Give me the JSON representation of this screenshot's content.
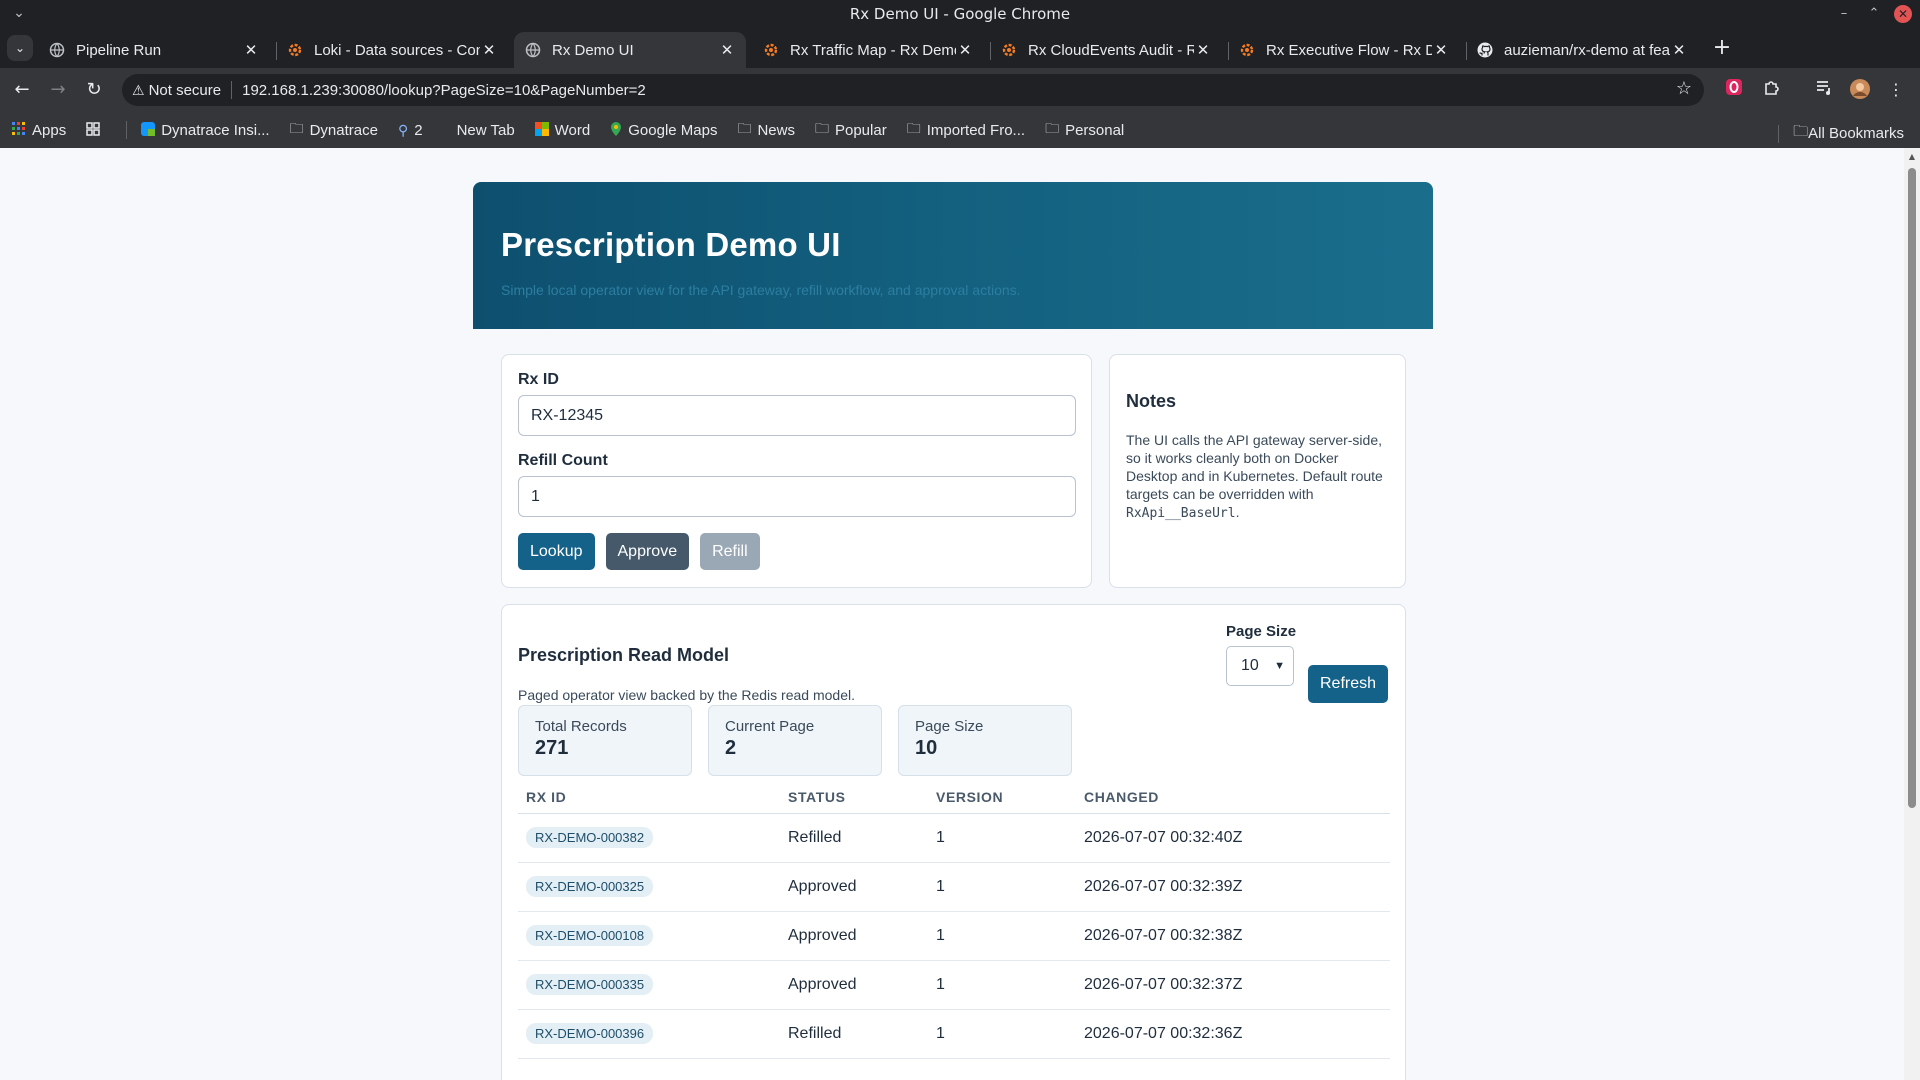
{
  "window": {
    "title": "Rx Demo UI - Google Chrome"
  },
  "tabs": [
    {
      "label": "Pipeline Run",
      "icon": "globe-icon"
    },
    {
      "label": "Loki - Data sources - Con",
      "icon": "grafana-icon"
    },
    {
      "label": "Rx Demo UI",
      "icon": "globe-icon"
    },
    {
      "label": "Rx Traffic Map - Rx Demo",
      "icon": "grafana-icon"
    },
    {
      "label": "Rx CloudEvents Audit - R",
      "icon": "grafana-icon"
    },
    {
      "label": "Rx Executive Flow - Rx De",
      "icon": "grafana-icon"
    },
    {
      "label": "auzieman/rx-demo at fea",
      "icon": "github-icon"
    }
  ],
  "omnibox": {
    "security": "Not secure",
    "url": "192.168.1.239:30080/lookup?PageSize=10&PageNumber=2"
  },
  "bookmarks": {
    "items": [
      {
        "label": "Apps",
        "icon": "apps-grid-icon"
      },
      {
        "label": "Dynatrace Insi...",
        "icon": "dynatrace-icon"
      },
      {
        "label": "Dynatrace",
        "icon": "folder-icon"
      },
      {
        "label": "2",
        "icon": "search-icon"
      },
      {
        "label": "New Tab",
        "icon": "blank-icon"
      },
      {
        "label": "Word",
        "icon": "word-icon"
      },
      {
        "label": "Google Maps",
        "icon": "maps-icon"
      },
      {
        "label": "News",
        "icon": "folder-icon"
      },
      {
        "label": "Popular",
        "icon": "folder-icon"
      },
      {
        "label": "Imported Fro...",
        "icon": "folder-icon"
      },
      {
        "label": "Personal",
        "icon": "folder-icon"
      }
    ],
    "all_bookmarks": "All Bookmarks"
  },
  "page": {
    "title": "Prescription Demo UI",
    "subtitle": "Simple local operator view for the API gateway, refill workflow, and approval actions.",
    "form": {
      "rx_id_label": "Rx ID",
      "rx_id_value": "RX-12345",
      "refill_label": "Refill Count",
      "refill_value": "1",
      "lookup_label": "Lookup",
      "approve_label": "Approve",
      "refill_button_label": "Refill"
    },
    "notes": {
      "title": "Notes",
      "body_before": "The UI calls the API gateway server-side, so it works cleanly both on Docker Desktop and in Kubernetes. Default route targets can be overridden with",
      "code": "RxApi__BaseUrl",
      "body_after": "."
    },
    "read_model": {
      "title": "Prescription Read Model",
      "description": "Paged operator view backed by the Redis read model.",
      "page_size_label": "Page Size",
      "page_size_value": "10",
      "refresh_label": "Refresh",
      "stats": [
        {
          "label": "Total Records",
          "value": "271"
        },
        {
          "label": "Current Page",
          "value": "2"
        },
        {
          "label": "Page Size",
          "value": "10"
        }
      ],
      "columns": [
        "RX ID",
        "STATUS",
        "VERSION",
        "CHANGED"
      ],
      "rows": [
        {
          "rx_id": "RX-DEMO-000382",
          "status": "Refilled",
          "version": "1",
          "changed": "2026-07-07 00:32:40Z"
        },
        {
          "rx_id": "RX-DEMO-000325",
          "status": "Approved",
          "version": "1",
          "changed": "2026-07-07 00:32:39Z"
        },
        {
          "rx_id": "RX-DEMO-000108",
          "status": "Approved",
          "version": "1",
          "changed": "2026-07-07 00:32:38Z"
        },
        {
          "rx_id": "RX-DEMO-000335",
          "status": "Approved",
          "version": "1",
          "changed": "2026-07-07 00:32:37Z"
        },
        {
          "rx_id": "RX-DEMO-000396",
          "status": "Refilled",
          "version": "1",
          "changed": "2026-07-07 00:32:36Z"
        }
      ]
    }
  },
  "colors": {
    "hero_start": "#0e4f6e",
    "hero_end": "#1a6e8c",
    "primary_button": "#14628a",
    "dark_button": "#45596b",
    "muted_button": "#9aa7b5"
  }
}
